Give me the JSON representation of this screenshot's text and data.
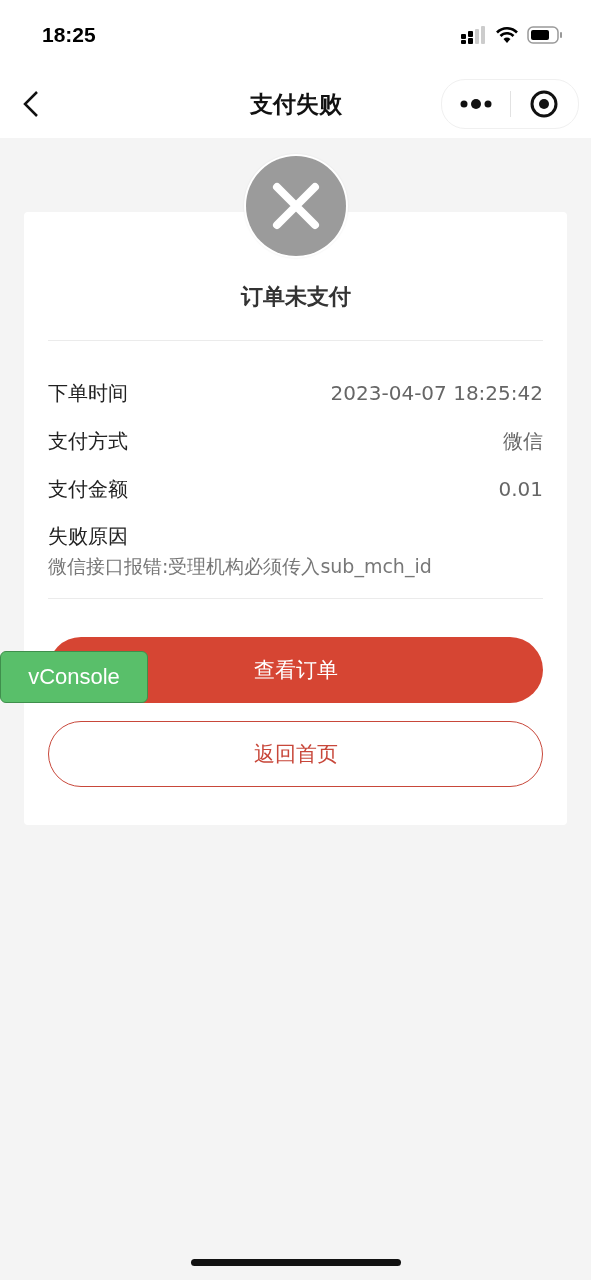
{
  "status_bar": {
    "time": "18:25"
  },
  "nav": {
    "title": "支付失败"
  },
  "result": {
    "title": "订单未支付"
  },
  "details": [
    {
      "label": "下单时间",
      "value": "2023-04-07 18:25:42"
    },
    {
      "label": "支付方式",
      "value": "微信"
    },
    {
      "label": "支付金额",
      "value": "0.01"
    }
  ],
  "failure": {
    "label": "失败原因",
    "reason": "微信接口报错:受理机构必须传入sub_mch_id"
  },
  "buttons": [
    {
      "label": "查看订单",
      "kind": "primary"
    },
    {
      "label": "返回首页",
      "kind": "outline"
    }
  ],
  "debug_badge": {
    "label": "vConsole"
  }
}
